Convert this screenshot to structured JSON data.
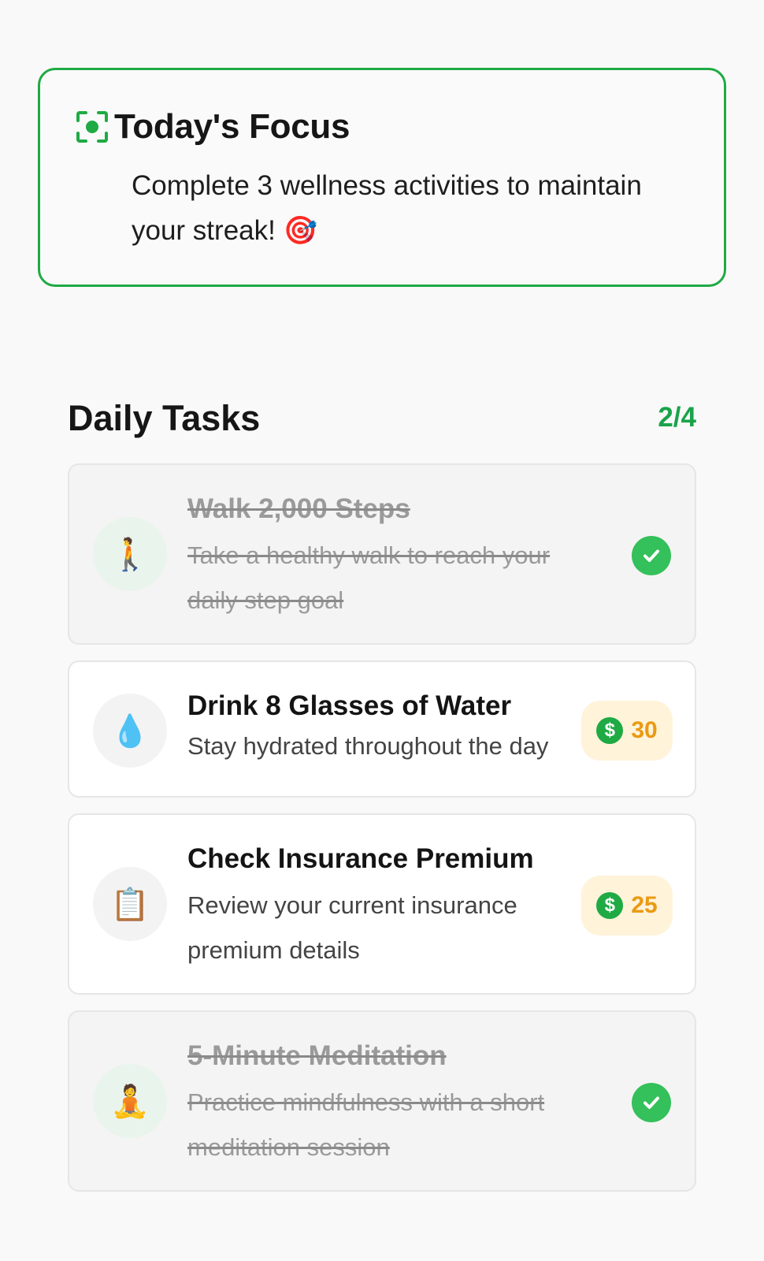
{
  "focus": {
    "title": "Today's Focus",
    "text": "Complete 3 wellness activities to maintain your streak! 🎯"
  },
  "tasks_header": {
    "title": "Daily Tasks",
    "count": "2/4"
  },
  "tasks": [
    {
      "icon": "🚶",
      "icon_name": "walking-person-icon",
      "title": "Walk 2,000 Steps",
      "description": "Take a healthy walk to reach your daily step goal",
      "completed": true
    },
    {
      "icon": "💧",
      "icon_name": "water-drop-icon",
      "title": "Drink 8 Glasses of Water",
      "description": "Stay hydrated throughout the day",
      "completed": false,
      "reward": "30"
    },
    {
      "icon": "📋",
      "icon_name": "clipboard-icon",
      "title": "Check Insurance Premium",
      "description": "Review your current insurance premium details",
      "completed": false,
      "reward": "25"
    },
    {
      "icon": "🧘",
      "icon_name": "meditation-person-icon",
      "title": "5-Minute Meditation",
      "description": "Practice mindfulness with a short meditation session",
      "completed": true
    }
  ],
  "colors": {
    "accent_green": "#1faa44",
    "reward_bg": "#fff3da",
    "reward_text": "#ea9a12",
    "check_green": "#34c05a"
  }
}
